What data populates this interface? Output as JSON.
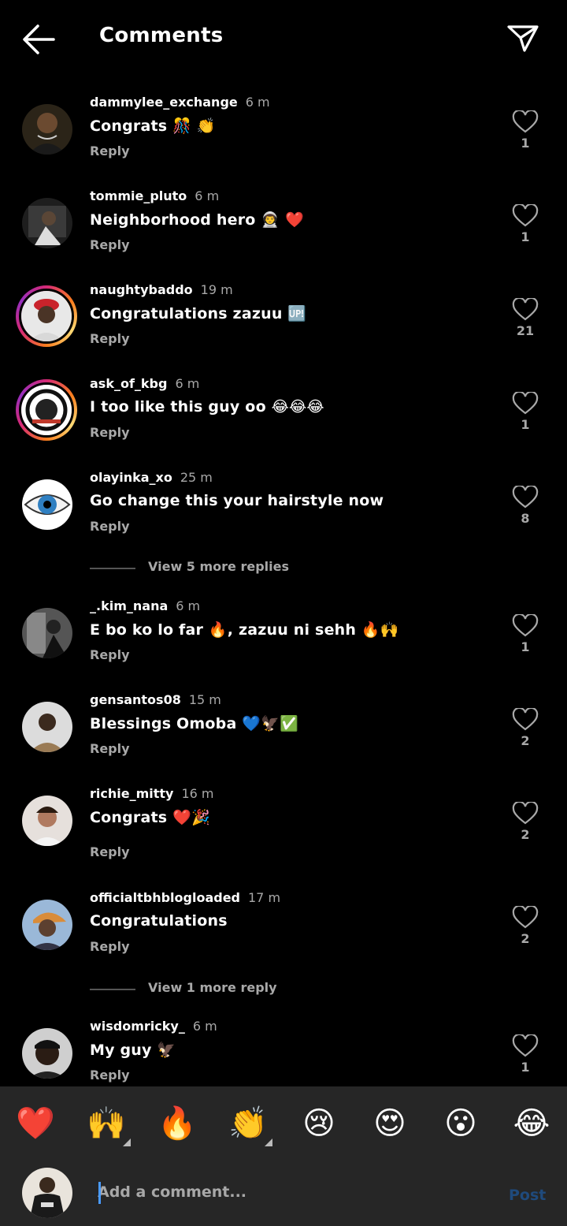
{
  "header": {
    "title": "Comments"
  },
  "comments": [
    {
      "username": "dammylee_exchange",
      "time": "6 m",
      "text": "Congrats 🎊 👏",
      "reply": "Reply",
      "likes": "1"
    },
    {
      "username": "tommie_pluto",
      "time": "6 m",
      "text": "Neighborhood hero 👨‍🚀 ❤️",
      "reply": "Reply",
      "likes": "1"
    },
    {
      "username": "naughtybaddo",
      "time": "19 m",
      "text": "Congratulations zazuu 🆙",
      "reply": "Reply",
      "likes": "21"
    },
    {
      "username": "ask_of_kbg",
      "time": "6 m",
      "text": "I too like this guy oo 😂😂😂",
      "reply": "Reply",
      "likes": "1"
    },
    {
      "username": "olayinka_xo",
      "time": "25 m",
      "text": "Go change this your hairstyle now",
      "reply": "Reply",
      "likes": "8"
    },
    {
      "username": "_.kim_nana",
      "time": "6 m",
      "text": "E bo ko lo far 🔥, zazuu ni sehh 🔥🙌",
      "reply": "Reply",
      "likes": "1"
    },
    {
      "username": "gensantos08",
      "time": "15 m",
      "text": "Blessings Omoba 💙🦅✅",
      "reply": "Reply",
      "likes": "2"
    },
    {
      "username": "richie_mitty",
      "time": "16 m",
      "text": "Congrats ❤️🎉",
      "reply": "Reply",
      "likes": "2"
    },
    {
      "username": "officialtbhblogloaded",
      "time": "17 m",
      "text": "Congratulations",
      "reply": "Reply",
      "likes": "2"
    },
    {
      "username": "wisdomricky_",
      "time": "6 m",
      "text": "My guy 🦅",
      "reply": "Reply",
      "likes": "1"
    }
  ],
  "view_more": [
    {
      "label": "View 5 more replies"
    },
    {
      "label": "View 1 more reply"
    }
  ],
  "quick_reactions": [
    "❤️",
    "🙌",
    "🔥",
    "👏",
    "😢",
    "😍",
    "😮",
    "😂"
  ],
  "composer": {
    "placeholder": "Add a comment...",
    "post_label": "Post"
  },
  "colors": {
    "background": "#000000",
    "secondary_text": "#a8a8a8",
    "bar_background": "#262626",
    "post_disabled": "#1f4a7c"
  }
}
